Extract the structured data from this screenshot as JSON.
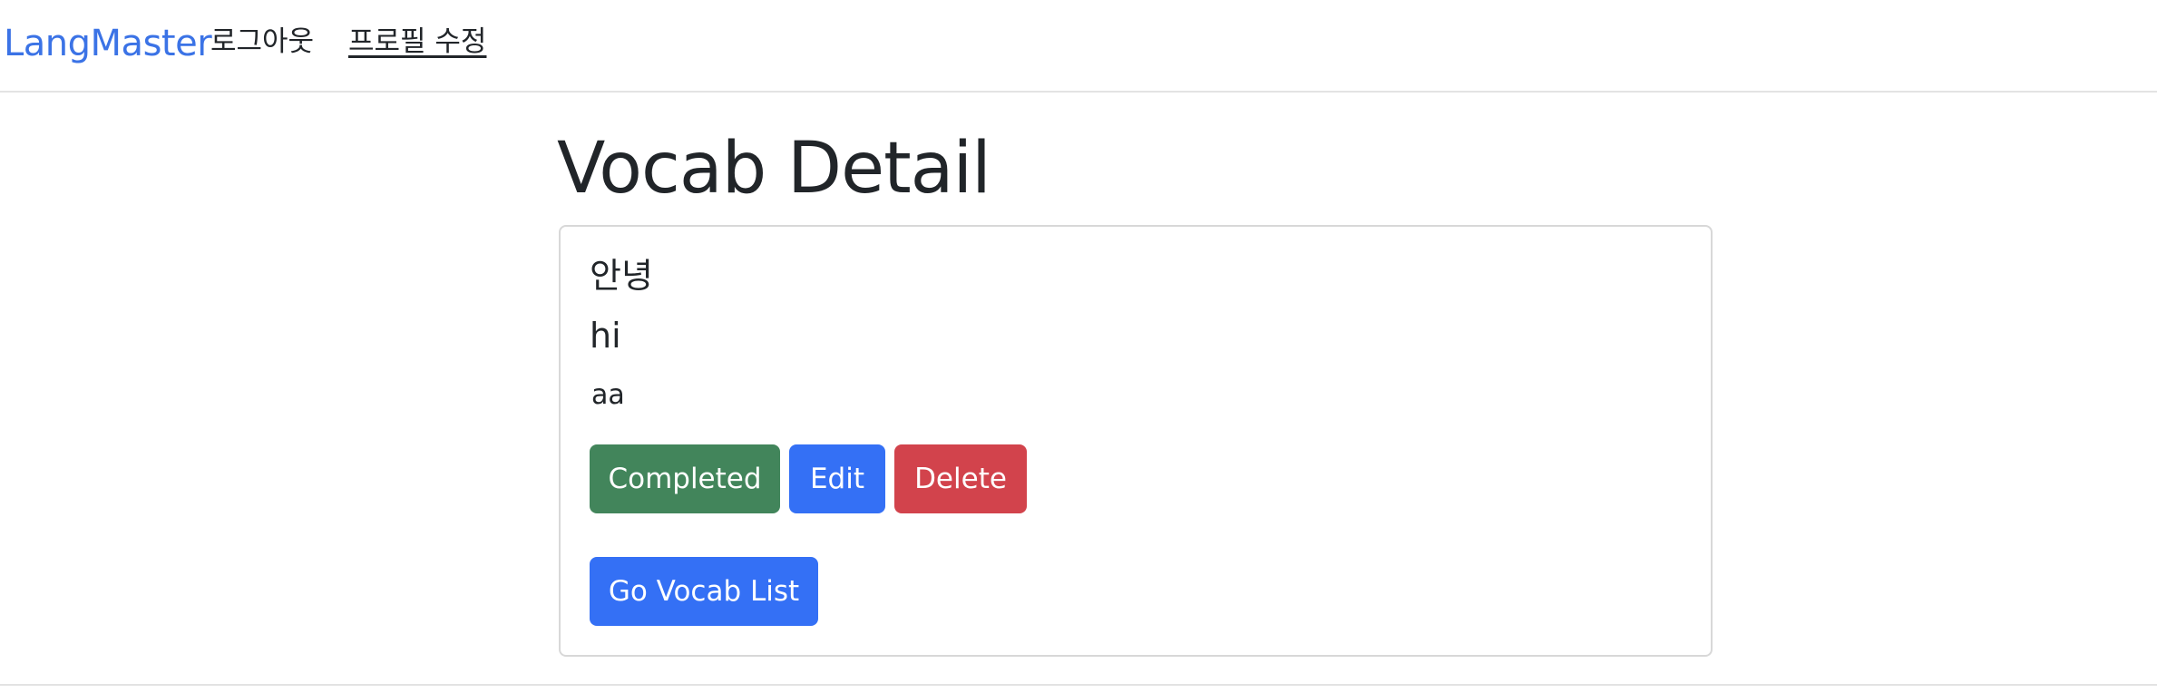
{
  "navbar": {
    "brand": "LangMaster",
    "logout": "로그아웃",
    "profile_edit": "프로필 수정"
  },
  "page": {
    "title": "Vocab Detail"
  },
  "vocab": {
    "word": "안녕",
    "meaning": "hi",
    "example": "aa"
  },
  "actions": {
    "completed": "Completed",
    "edit": "Edit",
    "delete": "Delete",
    "go_list": "Go Vocab List"
  },
  "colors": {
    "brand": "#3b73e6",
    "success": "#42855b",
    "primary": "#3470f5",
    "danger": "#d2434c"
  }
}
